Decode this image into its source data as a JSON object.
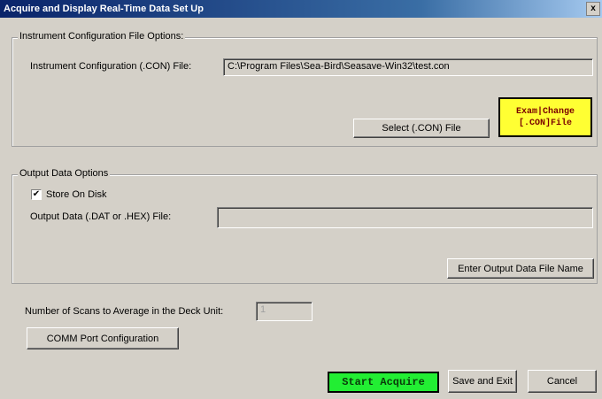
{
  "window": {
    "title": "Acquire and Display Real-Time Data Set Up",
    "close_label": "x"
  },
  "instrument_group": {
    "legend": "Instrument Configuration File Options:",
    "file_label": "Instrument Configuration (.CON) File:",
    "file_value": "C:\\Program Files\\Sea-Bird\\Seasave-Win32\\test.con",
    "select_button": "Select (.CON) File",
    "examine_line1": "Exam|Change",
    "examine_line2": "[.CON]File"
  },
  "output_group": {
    "legend": "Output Data Options",
    "store_checkbox_label": "Store On Disk",
    "store_checked": true,
    "output_file_label": "Output Data (.DAT or .HEX) File:",
    "output_file_value": "",
    "enter_button": "Enter Output Data File Name"
  },
  "scans": {
    "label": "Number of Scans to Average in the Deck Unit:",
    "value": "1"
  },
  "buttons": {
    "comm_port": "COMM Port Configuration",
    "start_acquire": "Start Acquire",
    "save_exit": "Save and Exit",
    "cancel": "Cancel"
  },
  "colors": {
    "title_bar": "#0a246a",
    "window_bg": "#d4d0c8",
    "examine_bg": "#ffff33",
    "start_bg": "#22ee33"
  }
}
